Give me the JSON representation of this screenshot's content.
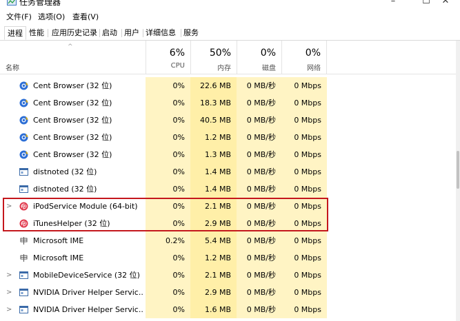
{
  "window": {
    "title": "任务管理器",
    "minimize": "–",
    "maximize": "☐",
    "close": "✕"
  },
  "menu": [
    {
      "label": "文件(F)"
    },
    {
      "label": "选项(O)"
    },
    {
      "label": "查看(V)"
    }
  ],
  "tabs": [
    {
      "label": "进程",
      "active": true
    },
    {
      "label": "性能"
    },
    {
      "label": "应用历史记录"
    },
    {
      "label": "启动"
    },
    {
      "label": "用户"
    },
    {
      "label": "详细信息"
    },
    {
      "label": "服务"
    }
  ],
  "header": {
    "name": "名称",
    "cpu": {
      "pct": "6%",
      "label": "CPU"
    },
    "mem": {
      "pct": "50%",
      "label": "内存"
    },
    "disk": {
      "pct": "0%",
      "label": "磁盘"
    },
    "net": {
      "pct": "0%",
      "label": "网络"
    }
  },
  "colors": {
    "highlight": "#c4161c",
    "heat_light": "#fff4c4",
    "heat_mem": "#ffefa8"
  },
  "processes": [
    {
      "name": "Cent Browser (32 位)",
      "icon": "cent-browser-icon",
      "expandable": false,
      "cpu": "0%",
      "mem": "22.6 MB",
      "disk": "0 MB/秒",
      "net": "0 Mbps"
    },
    {
      "name": "Cent Browser (32 位)",
      "icon": "cent-browser-icon",
      "expandable": false,
      "cpu": "0%",
      "mem": "18.3 MB",
      "disk": "0 MB/秒",
      "net": "0 Mbps"
    },
    {
      "name": "Cent Browser (32 位)",
      "icon": "cent-browser-icon",
      "expandable": false,
      "cpu": "0%",
      "mem": "40.5 MB",
      "disk": "0 MB/秒",
      "net": "0 Mbps"
    },
    {
      "name": "Cent Browser (32 位)",
      "icon": "cent-browser-icon",
      "expandable": false,
      "cpu": "0%",
      "mem": "1.2 MB",
      "disk": "0 MB/秒",
      "net": "0 Mbps"
    },
    {
      "name": "Cent Browser (32 位)",
      "icon": "cent-browser-icon",
      "expandable": false,
      "cpu": "0%",
      "mem": "1.3 MB",
      "disk": "0 MB/秒",
      "net": "0 Mbps"
    },
    {
      "name": "distnoted (32 位)",
      "icon": "app-window-icon",
      "expandable": false,
      "cpu": "0%",
      "mem": "1.4 MB",
      "disk": "0 MB/秒",
      "net": "0 Mbps"
    },
    {
      "name": "distnoted (32 位)",
      "icon": "app-window-icon",
      "expandable": false,
      "cpu": "0%",
      "mem": "1.4 MB",
      "disk": "0 MB/秒",
      "net": "0 Mbps"
    },
    {
      "name": "iPodService Module (64-bit)",
      "icon": "itunes-icon",
      "expandable": true,
      "cpu": "0%",
      "mem": "2.1 MB",
      "disk": "0 MB/秒",
      "net": "0 Mbps"
    },
    {
      "name": "iTunesHelper (32 位)",
      "icon": "itunes-icon",
      "expandable": false,
      "cpu": "0%",
      "mem": "2.9 MB",
      "disk": "0 MB/秒",
      "net": "0 Mbps"
    },
    {
      "name": "Microsoft IME",
      "icon": "ime-icon",
      "expandable": false,
      "cpu": "0.2%",
      "mem": "5.4 MB",
      "disk": "0 MB/秒",
      "net": "0 Mbps"
    },
    {
      "name": "Microsoft IME",
      "icon": "ime-icon",
      "expandable": false,
      "cpu": "0%",
      "mem": "1.2 MB",
      "disk": "0 MB/秒",
      "net": "0 Mbps"
    },
    {
      "name": "MobileDeviceService (32 位)",
      "icon": "app-window-icon",
      "expandable": true,
      "cpu": "0%",
      "mem": "2.1 MB",
      "disk": "0 MB/秒",
      "net": "0 Mbps"
    },
    {
      "name": "NVIDIA Driver Helper Servic...",
      "icon": "app-window-icon",
      "expandable": true,
      "cpu": "0%",
      "mem": "2.9 MB",
      "disk": "0 MB/秒",
      "net": "0 Mbps"
    },
    {
      "name": "NVIDIA Driver Helper Servic...",
      "icon": "app-window-icon",
      "expandable": true,
      "cpu": "0%",
      "mem": "1.6 MB",
      "disk": "0 MB/秒",
      "net": "0 Mbps"
    }
  ]
}
